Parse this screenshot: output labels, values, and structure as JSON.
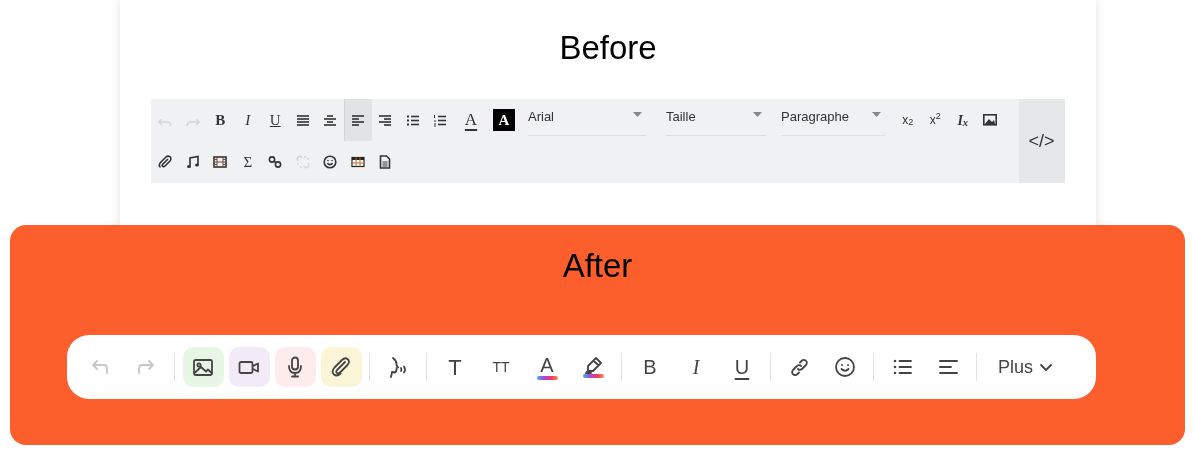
{
  "before": {
    "title": "Before",
    "rows": [
      [
        {
          "kind": "undo",
          "disabled": true,
          "selected": false
        },
        {
          "kind": "redo",
          "disabled": true,
          "selected": false
        },
        {
          "kind": "bold",
          "text": "B",
          "disabled": false,
          "selected": false
        },
        {
          "kind": "italic",
          "text": "I",
          "disabled": false,
          "selected": false
        },
        {
          "kind": "underline",
          "text": "U",
          "disabled": false,
          "selected": false
        },
        {
          "kind": "justify",
          "disabled": false,
          "selected": false
        },
        {
          "kind": "center",
          "disabled": false,
          "selected": false
        },
        {
          "kind": "left",
          "disabled": false,
          "selected": true
        },
        {
          "kind": "right",
          "disabled": false,
          "selected": false
        },
        {
          "kind": "bullet-list",
          "disabled": false,
          "selected": false
        },
        {
          "kind": "number-list",
          "disabled": false,
          "selected": false
        },
        {
          "kind": "font-color",
          "text": "A",
          "disabled": false,
          "selected": false
        },
        {
          "kind": "back-color",
          "text": "A",
          "disabled": false,
          "selected": false
        },
        {
          "kind": "select",
          "text": "Arial"
        },
        {
          "kind": "select",
          "text": "Taille"
        },
        {
          "kind": "select",
          "text": "Paragraphe"
        },
        {
          "kind": "script",
          "text": "x$_{2}$",
          "disabled": false,
          "selected": false
        },
        {
          "kind": "script",
          "text": "x$^{2}$",
          "disabled": false,
          "selected": false
        },
        {
          "kind": "clear-format",
          "text": "I$_{x}$",
          "disabled": false,
          "selected": false
        },
        {
          "kind": "image",
          "disabled": false,
          "selected": false
        }
      ],
      [
        {
          "kind": "attach",
          "disabled": false,
          "selected": false
        },
        {
          "kind": "music",
          "disabled": false,
          "selected": false
        },
        {
          "kind": "film",
          "disabled": false,
          "selected": false
        },
        {
          "kind": "formula",
          "text": "Σ",
          "disabled": false,
          "selected": false
        },
        {
          "kind": "link",
          "disabled": false,
          "selected": false
        },
        {
          "kind": "unlink",
          "disabled": true,
          "selected": false
        },
        {
          "kind": "emoji",
          "disabled": false,
          "selected": false
        },
        {
          "kind": "table",
          "disabled": false,
          "selected": false
        },
        {
          "kind": "document",
          "disabled": false,
          "selected": false
        }
      ]
    ],
    "source_button": "</>"
  },
  "after": {
    "title": "After",
    "groups": [
      [
        {
          "kind": "undo",
          "disabled": true
        },
        {
          "kind": "redo",
          "disabled": true
        }
      ],
      [
        {
          "kind": "image",
          "disabled": false,
          "color": "#e8f6e6"
        },
        {
          "kind": "video",
          "disabled": false,
          "color": "#f3eaf8"
        },
        {
          "kind": "mic",
          "disabled": false,
          "color": "#fdebee"
        },
        {
          "kind": "attach",
          "disabled": false,
          "color": "#fbf5d8"
        }
      ],
      [
        {
          "kind": "voice",
          "disabled": false
        }
      ],
      [
        {
          "kind": "text",
          "text": "T",
          "disabled": false
        },
        {
          "kind": "text-size",
          "text": "TT",
          "disabled": false
        },
        {
          "kind": "font-color",
          "text": "A",
          "disabled": false
        },
        {
          "kind": "highlight",
          "disabled": false
        }
      ],
      [
        {
          "kind": "bold",
          "text": "B",
          "disabled": false
        },
        {
          "kind": "italic",
          "text": "I",
          "disabled": false
        },
        {
          "kind": "underline",
          "text": "U",
          "disabled": false
        }
      ],
      [
        {
          "kind": "link",
          "disabled": false
        },
        {
          "kind": "emoji",
          "disabled": false
        }
      ],
      [
        {
          "kind": "bullet-list",
          "disabled": false
        },
        {
          "kind": "align",
          "disabled": false
        }
      ],
      [
        {
          "kind": "more",
          "text": "Plus",
          "disabled": false
        }
      ]
    ]
  }
}
